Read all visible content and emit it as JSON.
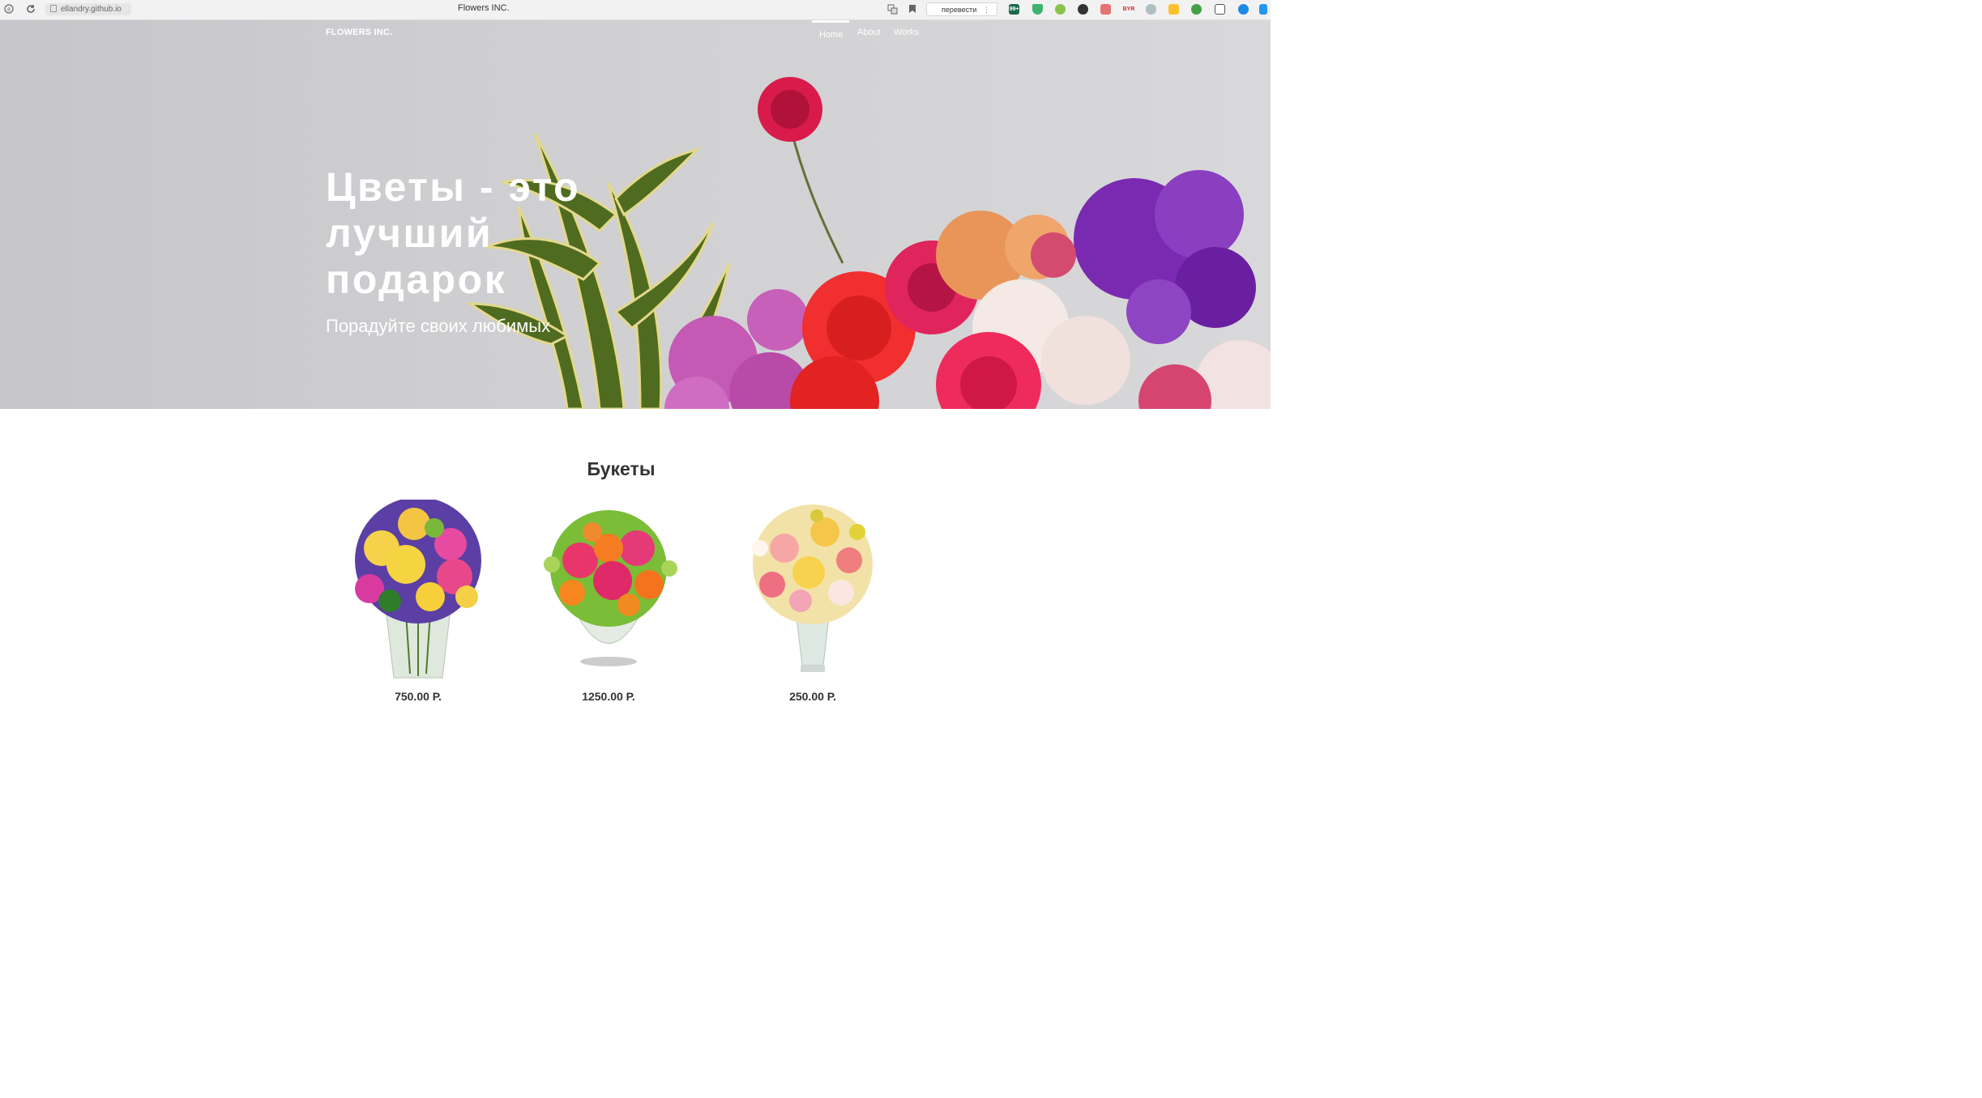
{
  "browser": {
    "url": "ellandry.github.io",
    "tab_title": "Flowers INC.",
    "translate_label": "перевести",
    "translate_more": "⋮",
    "ext_labels": {
      "ext1": "99+",
      "ext7": "BYR"
    }
  },
  "header": {
    "brand": "FLOWERS INC.",
    "nav": [
      {
        "label": "Home",
        "active": true
      },
      {
        "label": "About",
        "active": false
      },
      {
        "label": "Works",
        "active": false
      }
    ]
  },
  "hero": {
    "title": "Цветы - это лучший подарок",
    "subtitle": "Порадуйте своих любимых"
  },
  "bouquets": {
    "title": "Букеты",
    "items": [
      {
        "price": "750.00 Р."
      },
      {
        "price": "1250.00 Р."
      },
      {
        "price": "250.00 Р."
      }
    ]
  },
  "colors": {
    "accent": "#ffffff",
    "hero_bg": "#cfcfd2",
    "text": "#333333"
  }
}
